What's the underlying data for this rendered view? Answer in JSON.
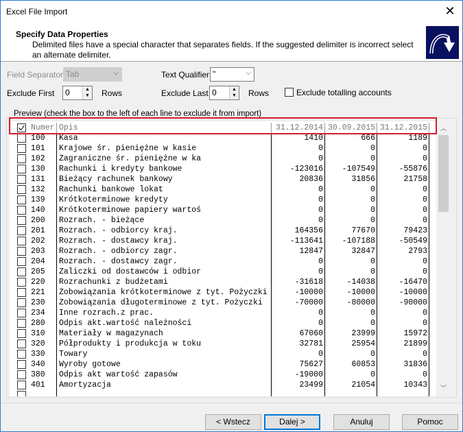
{
  "window": {
    "title": "Excel File Import"
  },
  "header": {
    "title": "Specify Data Properties",
    "description": "Delimited files have a special character that separates fields. If the suggested delimiter is incorrect select an alternate delimiter."
  },
  "options": {
    "field_separator_label": "Field Separator:",
    "field_separator_value": "Tab",
    "text_qualifier_label": "Text Qualifier:",
    "text_qualifier_value": "\"",
    "exclude_first_label": "Exclude First",
    "exclude_first_value": "0",
    "rows_label": "Rows",
    "exclude_last_label": "Exclude Last",
    "exclude_last_value": "0",
    "exclude_totalling_label": "Exclude totalling accounts",
    "exclude_totalling_checked": false
  },
  "preview": {
    "label": "Preview (check the box to the left of each line to exclude it from import)",
    "header": {
      "checked": true,
      "cols": [
        "Numer",
        "Opis",
        "31.12.2014",
        "30.09.2015",
        "31.12.2015"
      ]
    },
    "rows": [
      [
        "100",
        "Kasa",
        "1410",
        "666",
        "1189"
      ],
      [
        "101",
        "Krajowe śr. pieniężne w kasie",
        "0",
        "0",
        "0"
      ],
      [
        "102",
        "Zagraniczne śr. pieniężne w ka",
        "0",
        "0",
        "0"
      ],
      [
        "130",
        "Rachunki i kredyty bankowe",
        "-123016",
        "-107549",
        "-55876"
      ],
      [
        "131",
        "Bieżący rachunek bankowy",
        "20836",
        "31856",
        "21758"
      ],
      [
        "132",
        "Rachunki bankowe lokat",
        "0",
        "0",
        "0"
      ],
      [
        "139",
        "Krótkoterminowe kredyty",
        "0",
        "0",
        "0"
      ],
      [
        "140",
        "Krótkoterminowe papiery wartoś",
        "0",
        "0",
        "0"
      ],
      [
        "200",
        "Rozrach. - bieżące",
        "0",
        "0",
        "0"
      ],
      [
        "201",
        "Rozrach. - odbiorcy kraj.",
        "164356",
        "77670",
        "79423"
      ],
      [
        "202",
        "Rozrach. - dostawcy kraj.",
        "-113641",
        "-107188",
        "-50549"
      ],
      [
        "203",
        "Rozrach. - odbiorcy zagr.",
        "12847",
        "32847",
        "2793"
      ],
      [
        "204",
        "Rozrach. - dostawcy zagr.",
        "0",
        "0",
        "0"
      ],
      [
        "205",
        "Zaliczki od dostawców i odbior",
        "0",
        "0",
        "0"
      ],
      [
        "220",
        "Rozrachunki z budżetami",
        "-31618",
        "-14038",
        "-16470"
      ],
      [
        "221",
        "Zobowiązania krótkoterminowe z tyt. Pożyczki",
        "-10000",
        "-10000",
        "-10000"
      ],
      [
        "230",
        "Zobowiązania długoterminowe z tyt. Pożyczki",
        "-70000",
        "-80000",
        "-90000"
      ],
      [
        "234",
        "Inne rozrach.z prac.",
        "0",
        "0",
        "0"
      ],
      [
        "280",
        "Odpis akt.wartość należności",
        "0",
        "0",
        "0"
      ],
      [
        "310",
        "Materiały w magazynach",
        "67060",
        "23999",
        "15972"
      ],
      [
        "320",
        "Półprodukty i produkcja w toku",
        "32781",
        "25954",
        "21899"
      ],
      [
        "330",
        "Towary",
        "0",
        "0",
        "0"
      ],
      [
        "340",
        "Wyroby gotowe",
        "75627",
        "60853",
        "31836"
      ],
      [
        "380",
        "Odpis akt wartość zapasów",
        "-19000",
        "0",
        "0"
      ],
      [
        "401",
        "Amortyzacja",
        "23499",
        "21054",
        "10343"
      ]
    ]
  },
  "buttons": {
    "back": "< Wstecz",
    "next": "Dalej >",
    "cancel": "Anuluj",
    "help": "Pomoc"
  },
  "colors": {
    "highlight": "#d21e2b",
    "accent": "#0078d7"
  }
}
